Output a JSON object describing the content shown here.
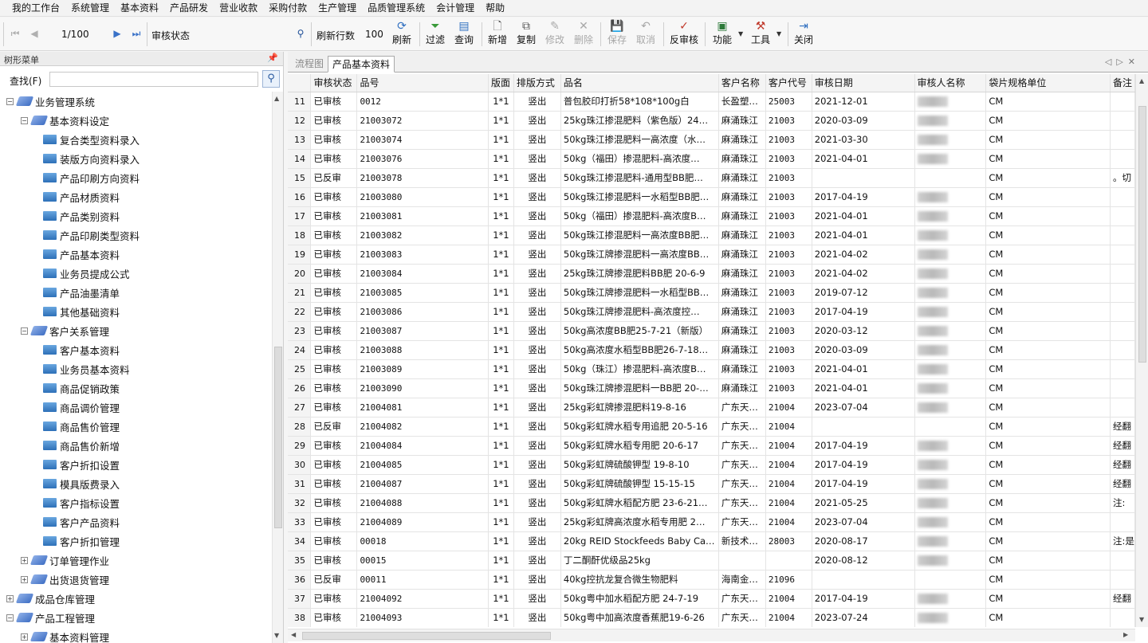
{
  "menu": [
    "我的工作台",
    "系统管理",
    "基本资料",
    "产品研发",
    "营业收款",
    "采购付款",
    "生产管理",
    "品质管理系统",
    "会计管理",
    "帮助"
  ],
  "toolbar": {
    "page_indicator": "1/100",
    "audit_status_label": "审核状态",
    "refresh_rows_label": "刷新行数",
    "refresh_rows_value": "100",
    "buttons": {
      "refresh": "刷新",
      "filter": "过滤",
      "query": "查询",
      "add": "新增",
      "copy": "复制",
      "modify": "修改",
      "delete": "删除",
      "save": "保存",
      "cancel": "取消",
      "reverse_audit": "反审核",
      "function": "功能",
      "tools": "工具",
      "close": "关闭"
    }
  },
  "left_panel": {
    "title": "树形菜单",
    "search_label": "查找(F)",
    "tree": [
      {
        "label": "业务管理系统",
        "level": 0,
        "expanded": true
      },
      {
        "label": "基本资料设定",
        "level": 1,
        "expanded": true
      },
      {
        "label": "复合类型资料录入",
        "level": 2
      },
      {
        "label": "装版方向资料录入",
        "level": 2
      },
      {
        "label": "产品印刷方向资料",
        "level": 2
      },
      {
        "label": "产品材质资料",
        "level": 2
      },
      {
        "label": "产品类别资料",
        "level": 2
      },
      {
        "label": "产品印刷类型资料",
        "level": 2
      },
      {
        "label": "产品基本资料",
        "level": 2
      },
      {
        "label": "业务员提成公式",
        "level": 2
      },
      {
        "label": "产品油墨清单",
        "level": 2
      },
      {
        "label": "其他基础资料",
        "level": 2
      },
      {
        "label": "客户关系管理",
        "level": 1,
        "expanded": true
      },
      {
        "label": "客户基本资料",
        "level": 2
      },
      {
        "label": "业务员基本资料",
        "level": 2
      },
      {
        "label": "商品促销政策",
        "level": 2
      },
      {
        "label": "商品调价管理",
        "level": 2
      },
      {
        "label": "商品售价管理",
        "level": 2
      },
      {
        "label": "商品售价新增",
        "level": 2
      },
      {
        "label": "客户折扣设置",
        "level": 2
      },
      {
        "label": "模具版费录入",
        "level": 2
      },
      {
        "label": "客户指标设置",
        "level": 2
      },
      {
        "label": "客户产品资料",
        "level": 2
      },
      {
        "label": "客户折扣管理",
        "level": 2
      },
      {
        "label": "订单管理作业",
        "level": 1,
        "expanded": false
      },
      {
        "label": "出货退货管理",
        "level": 1,
        "expanded": false
      },
      {
        "label": "成品仓库管理",
        "level": 0,
        "expanded": false
      },
      {
        "label": "产品工程管理",
        "level": 0,
        "expanded": true
      },
      {
        "label": "基本资料管理",
        "level": 1,
        "expanded": false
      }
    ]
  },
  "tabs": [
    {
      "label": "流程图",
      "active": false
    },
    {
      "label": "产品基本资料",
      "active": true
    }
  ],
  "table": {
    "columns": [
      "",
      "审核状态",
      "品号",
      "版面",
      "排版方式",
      "品名",
      "客户名称",
      "客户代号",
      "审核日期",
      "审核人名称",
      "袋片规格单位",
      "备注"
    ],
    "rows": [
      [
        "11",
        "已审核",
        "0012",
        "1*1",
        "竖出",
        "普包胶印打折58*108*100g白",
        "长盈塑…",
        "25003",
        "2021-12-01",
        "",
        "CM",
        ""
      ],
      [
        "12",
        "已审核",
        "21003072",
        "1*1",
        "竖出",
        "25kg珠江掺混肥料（紫色版）24…",
        "麻涌珠江",
        "21003",
        "2020-03-09",
        "",
        "CM",
        ""
      ],
      [
        "13",
        "已审核",
        "21003074",
        "1*1",
        "竖出",
        "50kg珠江掺混肥料一高浓度（水…",
        "麻涌珠江",
        "21003",
        "2021-03-30",
        "",
        "CM",
        ""
      ],
      [
        "14",
        "已审核",
        "21003076",
        "1*1",
        "竖出",
        "50kg（福田）掺混肥料-高浓度…",
        "麻涌珠江",
        "21003",
        "2021-04-01",
        "",
        "CM",
        ""
      ],
      [
        "15",
        "已反审",
        "21003078",
        "1*1",
        "竖出",
        "50kg珠江掺混肥料-通用型BB肥…",
        "麻涌珠江",
        "21003",
        "",
        "",
        "CM",
        "。切"
      ],
      [
        "16",
        "已审核",
        "21003080",
        "1*1",
        "竖出",
        "50kg珠江掺混肥料一水稻型BB肥…",
        "麻涌珠江",
        "21003",
        "2017-04-19",
        "",
        "CM",
        ""
      ],
      [
        "17",
        "已审核",
        "21003081",
        "1*1",
        "竖出",
        "50kg（福田）掺混肥料-高浓度B…",
        "麻涌珠江",
        "21003",
        "2021-04-01",
        "",
        "CM",
        ""
      ],
      [
        "18",
        "已审核",
        "21003082",
        "1*1",
        "竖出",
        "50kg珠江掺混肥料一高浓度BB肥…",
        "麻涌珠江",
        "21003",
        "2021-04-01",
        "",
        "CM",
        ""
      ],
      [
        "19",
        "已审核",
        "21003083",
        "1*1",
        "竖出",
        "50kg珠江牌掺混肥料一高浓度BB…",
        "麻涌珠江",
        "21003",
        "2021-04-02",
        "",
        "CM",
        ""
      ],
      [
        "20",
        "已审核",
        "21003084",
        "1*1",
        "竖出",
        "25kg珠江牌掺混肥料BB肥 20-6-9",
        "麻涌珠江",
        "21003",
        "2021-04-02",
        "",
        "CM",
        ""
      ],
      [
        "21",
        "已审核",
        "21003085",
        "1*1",
        "竖出",
        "50kg珠江牌掺混肥料一水稻型BB…",
        "麻涌珠江",
        "21003",
        "2019-07-12",
        "",
        "CM",
        ""
      ],
      [
        "22",
        "已审核",
        "21003086",
        "1*1",
        "竖出",
        "50kg珠江牌掺混肥料-高浓度控…",
        "麻涌珠江",
        "21003",
        "2017-04-19",
        "",
        "CM",
        ""
      ],
      [
        "23",
        "已审核",
        "21003087",
        "1*1",
        "竖出",
        "50kg高浓度BB肥25-7-21（新版）",
        "麻涌珠江",
        "21003",
        "2020-03-12",
        "",
        "CM",
        ""
      ],
      [
        "24",
        "已审核",
        "21003088",
        "1*1",
        "竖出",
        "50kg高浓度水稻型BB肥26-7-18…",
        "麻涌珠江",
        "21003",
        "2020-03-09",
        "",
        "CM",
        ""
      ],
      [
        "25",
        "已审核",
        "21003089",
        "1*1",
        "竖出",
        "50kg（珠江）掺混肥料-高浓度B…",
        "麻涌珠江",
        "21003",
        "2021-04-01",
        "",
        "CM",
        ""
      ],
      [
        "26",
        "已审核",
        "21003090",
        "1*1",
        "竖出",
        "50kg珠江牌掺混肥料一BB肥 20-…",
        "麻涌珠江",
        "21003",
        "2021-04-01",
        "",
        "CM",
        ""
      ],
      [
        "27",
        "已审核",
        "21004081",
        "1*1",
        "竖出",
        "25kg彩虹牌掺混肥料19-8-16",
        "广东天…",
        "21004",
        "2023-07-04",
        "",
        "CM",
        ""
      ],
      [
        "28",
        "已反审",
        "21004082",
        "1*1",
        "竖出",
        "50kg彩虹牌水稻专用追肥 20-5-16",
        "广东天…",
        "21004",
        "",
        "",
        "CM",
        "经翻"
      ],
      [
        "29",
        "已审核",
        "21004084",
        "1*1",
        "竖出",
        "50kg彩虹牌水稻专用肥 20-6-17",
        "广东天…",
        "21004",
        "2017-04-19",
        "",
        "CM",
        "经翻"
      ],
      [
        "30",
        "已审核",
        "21004085",
        "1*1",
        "竖出",
        "50kg彩虹牌硫酸钾型 19-8-10",
        "广东天…",
        "21004",
        "2017-04-19",
        "",
        "CM",
        "经翻"
      ],
      [
        "31",
        "已审核",
        "21004087",
        "1*1",
        "竖出",
        "50kg彩虹牌硫酸钾型 15-15-15",
        "广东天…",
        "21004",
        "2017-04-19",
        "",
        "CM",
        "经翻"
      ],
      [
        "32",
        "已审核",
        "21004088",
        "1*1",
        "竖出",
        "50kg彩虹牌水稻配方肥 23-6-21…",
        "广东天…",
        "21004",
        "2021-05-25",
        "",
        "CM",
        "注:"
      ],
      [
        "33",
        "已审核",
        "21004089",
        "1*1",
        "竖出",
        "25kg彩虹牌高浓度水稻专用肥 2…",
        "广东天…",
        "21004",
        "2023-07-04",
        "",
        "CM",
        ""
      ],
      [
        "34",
        "已审核",
        "00018",
        "1*1",
        "竖出",
        "20kg REID Stockfeeds Baby Ca…",
        "新技术…",
        "28003",
        "2020-08-17",
        "",
        "CM",
        "注:是"
      ],
      [
        "35",
        "已审核",
        "00015",
        "1*1",
        "竖出",
        "丁二酮酐优级品25kg",
        "",
        "",
        "2020-08-12",
        "",
        "CM",
        ""
      ],
      [
        "36",
        "已反审",
        "00011",
        "1*1",
        "竖出",
        "40kg控抗龙复合微生物肥料",
        "海南金…",
        "21096",
        "",
        "",
        "CM",
        ""
      ],
      [
        "37",
        "已审核",
        "21004092",
        "1*1",
        "竖出",
        "50kg粤中加水稻配方肥 24-7-19",
        "广东天…",
        "21004",
        "2017-04-19",
        "",
        "CM",
        "经翻"
      ],
      [
        "38",
        "已审核",
        "21004093",
        "1*1",
        "竖出",
        "50kg粤中加高浓度香蕉肥19-6-26",
        "广东天…",
        "21004",
        "2023-07-24",
        "",
        "CM",
        ""
      ]
    ]
  },
  "colors": {
    "accent": "#3a72c8",
    "header_bg": "#f4f4f4",
    "grid_line": "#e4e4e4"
  }
}
